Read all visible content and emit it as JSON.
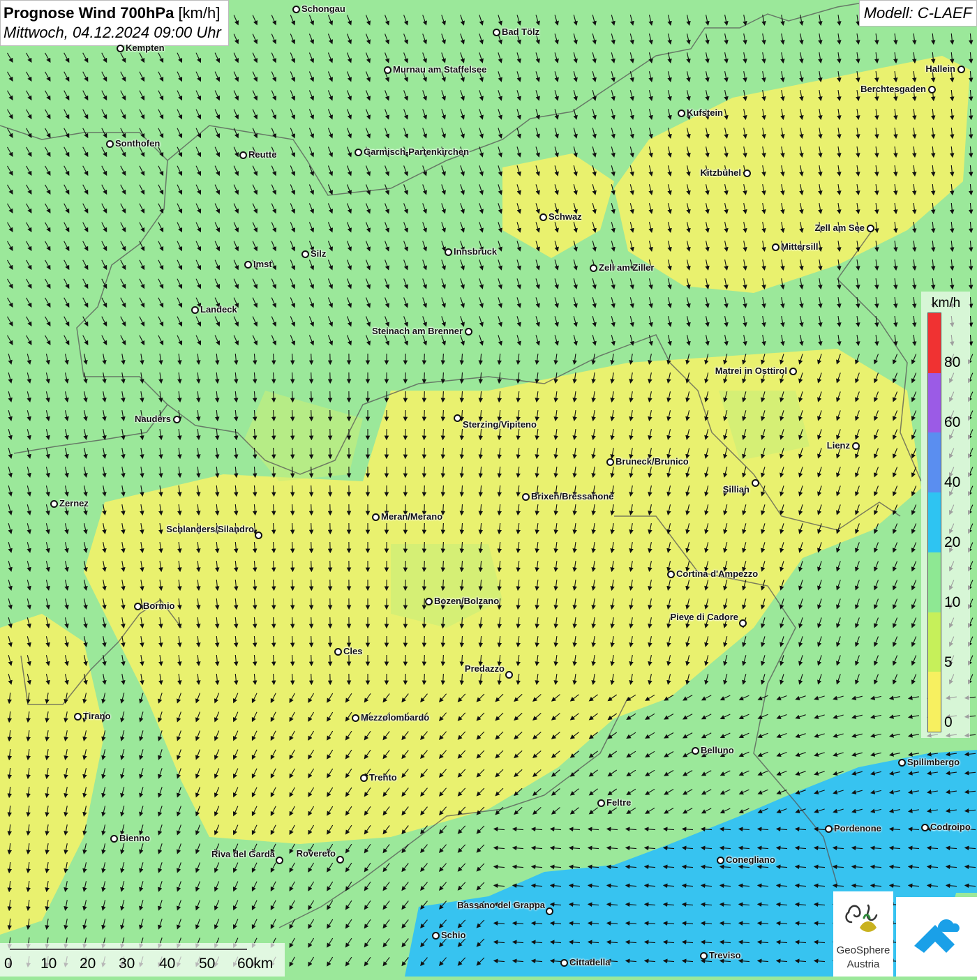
{
  "header": {
    "title_bold": "Prognose Wind 700hPa",
    "title_unit": "[km/h]",
    "subtitle": "Mittwoch, 04.12.2024 09:00 Uhr",
    "model": "Modell: C-LAEF"
  },
  "legend": {
    "unit": "km/h",
    "ticks": [
      "80",
      "60",
      "40",
      "20",
      "10",
      "5",
      "0"
    ],
    "colors": [
      "#f03232",
      "#9b5be6",
      "#5a8ef0",
      "#2ec4f2",
      "#8ee893",
      "#c6f05a",
      "#f7f060"
    ]
  },
  "scalebar": {
    "labels": [
      "0",
      "10",
      "20",
      "30",
      "40",
      "50",
      "60km"
    ]
  },
  "logos": {
    "geosphere_line1": "GeoSphere",
    "geosphere_line2": "Austria"
  },
  "cities": [
    {
      "name": "Schongau"
    },
    {
      "name": "Bad Tölz"
    },
    {
      "name": "Kempten"
    },
    {
      "name": "Murnau am Staffelsee"
    },
    {
      "name": "Hallein"
    },
    {
      "name": "Berchtesgaden"
    },
    {
      "name": "Kufstein"
    },
    {
      "name": "Sonthofen"
    },
    {
      "name": "Reutte"
    },
    {
      "name": "Garmisch-Partenkirchen"
    },
    {
      "name": "Kitzbühel"
    },
    {
      "name": "Schwaz"
    },
    {
      "name": "Zell am See"
    },
    {
      "name": "Mittersill"
    },
    {
      "name": "Innsbruck"
    },
    {
      "name": "Imst"
    },
    {
      "name": "Silz"
    },
    {
      "name": "Zell am Ziller"
    },
    {
      "name": "Landeck"
    },
    {
      "name": "Steinach am Brenner"
    },
    {
      "name": "Matrei in Osttirol"
    },
    {
      "name": "Nauders"
    },
    {
      "name": "Sterzing/Vipiteno"
    },
    {
      "name": "Lienz"
    },
    {
      "name": "Bruneck/Brunico"
    },
    {
      "name": "Sillian"
    },
    {
      "name": "Zernez"
    },
    {
      "name": "Brixen/Bressanone"
    },
    {
      "name": "Meran/Merano"
    },
    {
      "name": "Schlanders/Silandro"
    },
    {
      "name": "Cortina d'Ampezzo"
    },
    {
      "name": "Bormio"
    },
    {
      "name": "Bozen/Bolzano"
    },
    {
      "name": "Pieve di Cadore"
    },
    {
      "name": "Cles"
    },
    {
      "name": "Predazzo"
    },
    {
      "name": "Tirano"
    },
    {
      "name": "Mezzolombardo"
    },
    {
      "name": "Belluno"
    },
    {
      "name": "Spilimbergo"
    },
    {
      "name": "Trento"
    },
    {
      "name": "Feltre"
    },
    {
      "name": "Pordenone"
    },
    {
      "name": "Codroipo"
    },
    {
      "name": "Bienno"
    },
    {
      "name": "Riva del Garda"
    },
    {
      "name": "Rovereto"
    },
    {
      "name": "Conegliano"
    },
    {
      "name": "Bassano del Grappa"
    },
    {
      "name": "Schio"
    },
    {
      "name": "Treviso"
    },
    {
      "name": "Cittadella"
    }
  ]
}
